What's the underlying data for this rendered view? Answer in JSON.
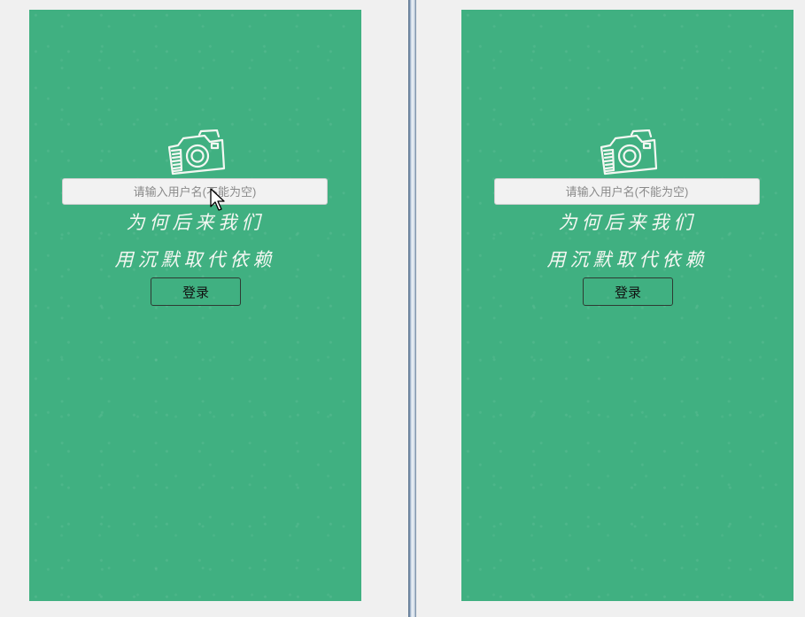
{
  "panels": [
    {
      "username_placeholder": "请输入用户名(不能为空)",
      "poem_line_1": "为何后来我们",
      "poem_line_2": "用沉默取代依赖",
      "login_label": "登录"
    },
    {
      "username_placeholder": "请输入用户名(不能为空)",
      "poem_line_1": "为何后来我们",
      "poem_line_2": "用沉默取代依赖",
      "login_label": "登录"
    }
  ],
  "colors": {
    "background": "#40b081",
    "window": "#f0f0f0",
    "sketch": "#f4f7f2"
  },
  "icons": {
    "camera": "camera-icon",
    "cursor": "mouse-pointer-icon"
  }
}
